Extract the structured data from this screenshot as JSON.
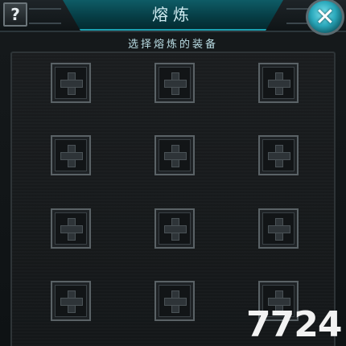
{
  "header": {
    "title": "熔炼",
    "help_label": "?",
    "close_label": "✕"
  },
  "subtitle": "选择熔炼的装备",
  "slots_count": 12,
  "watermark": "7724",
  "colors": {
    "accent": "#1aa0b0",
    "slot_border": "#5a6266",
    "background": "#0b0f11"
  }
}
